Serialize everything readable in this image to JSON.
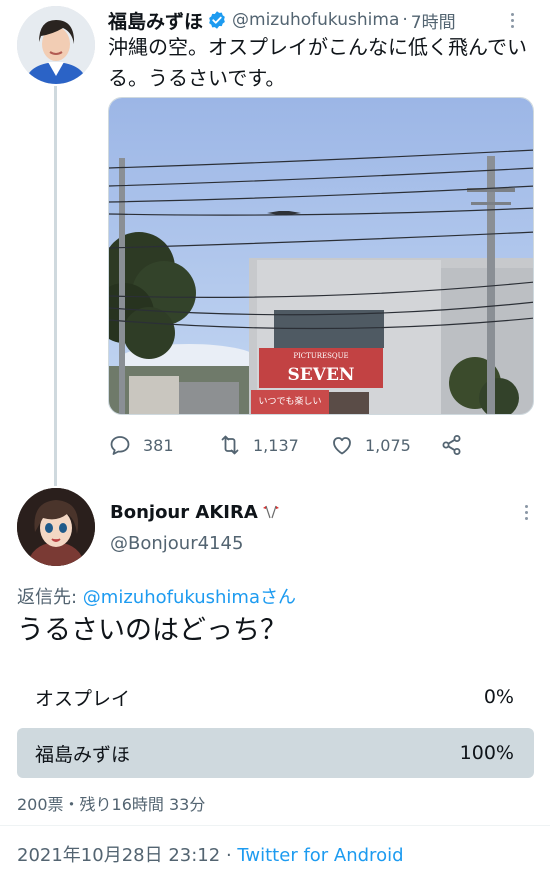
{
  "tweet": {
    "author_name": "福島みずほ",
    "handle": "@mizuhofukushima",
    "separator": "·",
    "time_ago": "7時間",
    "text": "沖縄の空。オスプレイがこんなに低く飛んでいる。うるさいです。",
    "photo_sign": "SEVEN",
    "photo_sign_top": "PICTURESQUE",
    "photo_banner": "いつでも楽しい",
    "replies": "381",
    "retweets": "1,137",
    "likes": "1,075"
  },
  "reply": {
    "author_name": "Bonjour AKIRA",
    "handle": "@Bonjour4145",
    "reply_to_prefix": "返信先: ",
    "reply_to_mention": "@mizuhofukushimaさん",
    "text": "うるさいのはどっち？",
    "poll": {
      "options": [
        {
          "label": "オスプレイ",
          "percent_text": "0%",
          "fraction": 0.0,
          "leading": false
        },
        {
          "label": "福島みずほ",
          "percent_text": "100%",
          "fraction": 1.0,
          "leading": true
        }
      ],
      "meta": "200票・残り16時間 33分"
    },
    "timestamp": "2021年10月28日 23:12",
    "timestamp_sep": " · ",
    "source": "Twitter for Android"
  },
  "colors": {
    "link": "#1d9bf0",
    "muted": "#536471",
    "poll_bar": "#cfd9de"
  }
}
